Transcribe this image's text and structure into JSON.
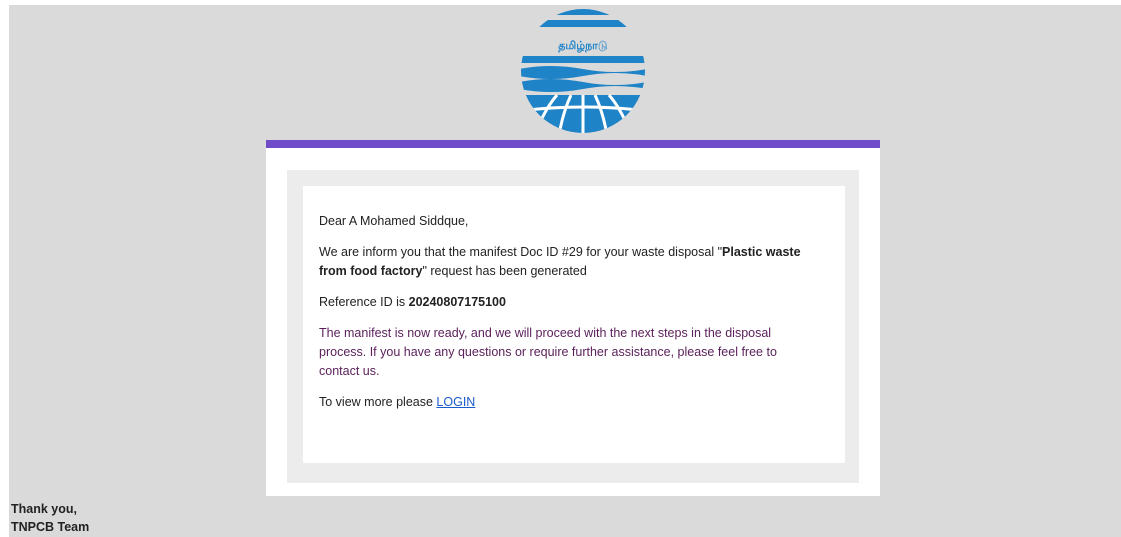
{
  "logo": {
    "icon": "tnpcb-globe-logo",
    "text": "தமிழ்நாடு",
    "color": "#1f83c8"
  },
  "accent_color": "#6f4bc9",
  "email": {
    "greeting": "Dear A Mohamed Siddque,",
    "intro_prefix": "We are inform you that the manifest Doc ID #29 for your waste disposal \"",
    "waste_name": "Plastic waste from food factory",
    "intro_suffix": "\" request has been generated",
    "reference_prefix": "Reference ID is ",
    "reference_id": "20240807175100",
    "next_steps": "The manifest is now ready, and we will proceed with the next steps in the disposal process. If you have any questions or require further assistance, please feel free to contact us.",
    "view_more_prefix": "To view more please ",
    "login_link": "LOGIN"
  },
  "signoff": {
    "thanks": "Thank you,",
    "team": "TNPCB Team"
  }
}
